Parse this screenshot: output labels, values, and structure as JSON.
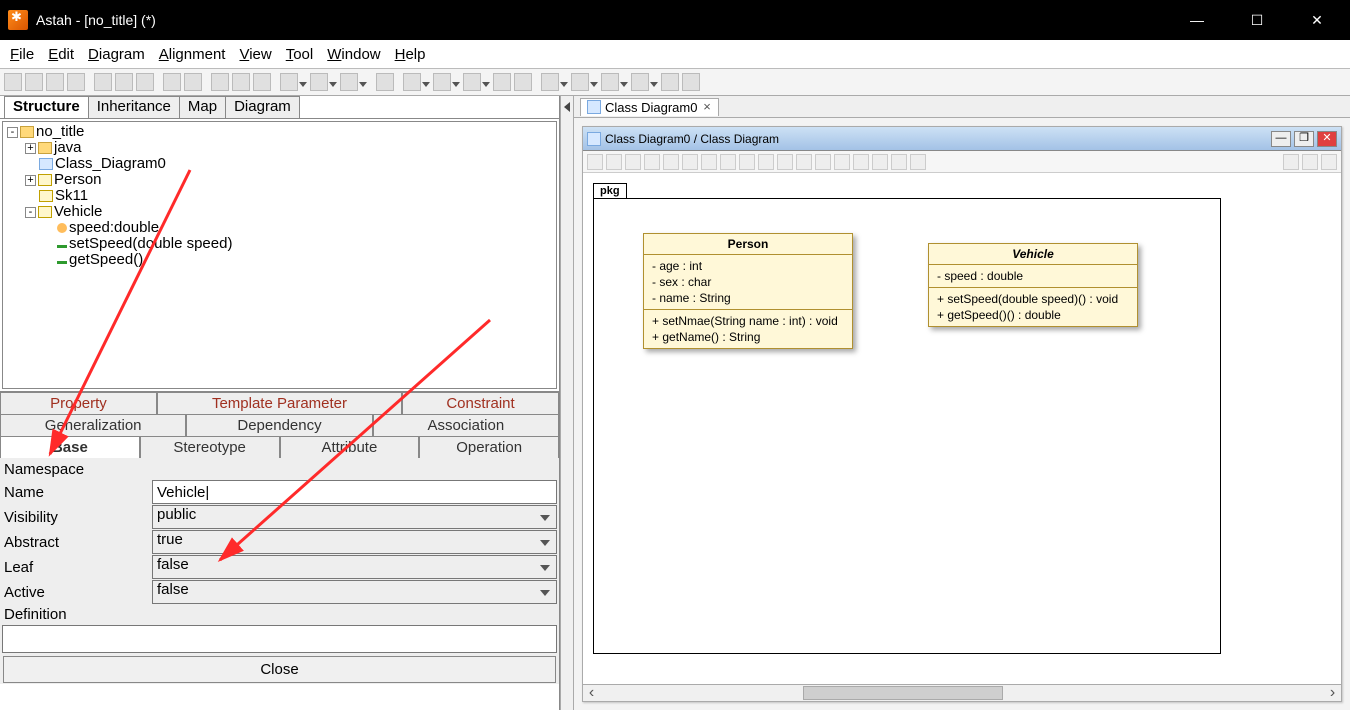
{
  "app": {
    "title": "Astah - [no_title] (*)"
  },
  "menus": [
    "File",
    "Edit",
    "Diagram",
    "Alignment",
    "View",
    "Tool",
    "Window",
    "Help"
  ],
  "structure": {
    "tabs": [
      "Structure",
      "Inheritance",
      "Map",
      "Diagram"
    ],
    "tree": {
      "root": "no_title",
      "java": "java",
      "diag": "Class_Diagram0",
      "person": "Person",
      "sk": "Sk11",
      "vehicle": "Vehicle",
      "speed": "speed:double",
      "setspeed": "setSpeed(double speed)",
      "getspeed": "getSpeed()"
    }
  },
  "prop": {
    "tabs_row1": [
      "Property",
      "Template Parameter",
      "Constraint"
    ],
    "tabs_row2": [
      "Generalization",
      "Dependency",
      "Association"
    ],
    "tabs_row3": [
      "Base",
      "Stereotype",
      "Attribute",
      "Operation"
    ],
    "labels": {
      "namespace": "Namespace",
      "name": "Name",
      "visibility": "Visibility",
      "abstract": "Abstract",
      "leaf": "Leaf",
      "active": "Active",
      "definition": "Definition",
      "close": "Close"
    },
    "values": {
      "name": "Vehicle|",
      "visibility": "public",
      "abstract": "true",
      "leaf": "false",
      "active": "false"
    }
  },
  "diagram": {
    "tab_label": "Class Diagram0",
    "window_title": "Class Diagram0 / Class Diagram",
    "pkg": "pkg",
    "person": {
      "name": "Person",
      "attrs": [
        "- age : int",
        "- sex : char",
        "- name : String"
      ],
      "ops": [
        "+ setNmae(String name : int) : void",
        "+ getName() : String"
      ]
    },
    "vehicle": {
      "name": "Vehicle",
      "attrs": [
        "- speed : double"
      ],
      "ops": [
        "+ setSpeed(double speed)() : void",
        "+ getSpeed()() : double"
      ]
    }
  }
}
